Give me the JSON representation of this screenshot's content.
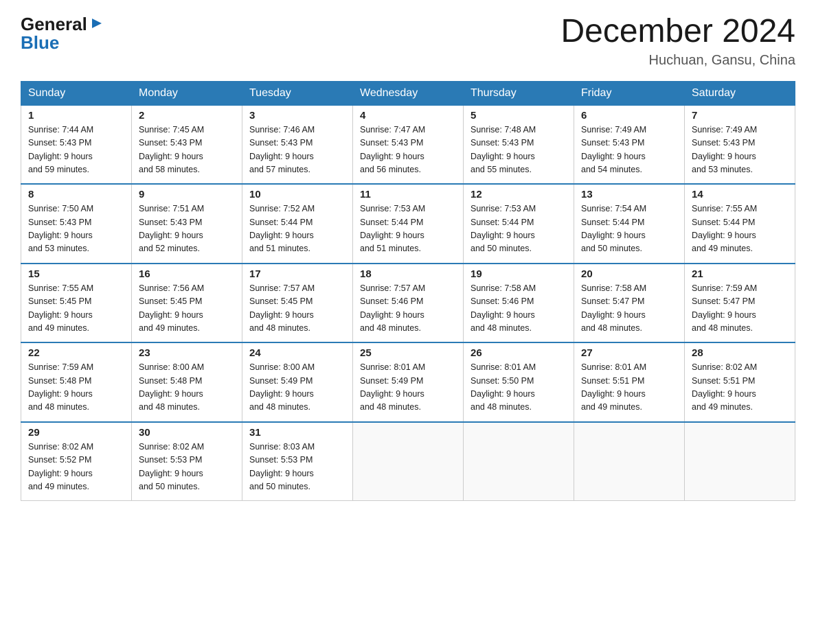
{
  "header": {
    "logo_line1": "General",
    "logo_line2": "Blue",
    "title": "December 2024",
    "subtitle": "Huchuan, Gansu, China"
  },
  "days_of_week": [
    "Sunday",
    "Monday",
    "Tuesday",
    "Wednesday",
    "Thursday",
    "Friday",
    "Saturday"
  ],
  "weeks": [
    [
      {
        "day": "1",
        "sunrise": "7:44 AM",
        "sunset": "5:43 PM",
        "daylight": "9 hours and 59 minutes."
      },
      {
        "day": "2",
        "sunrise": "7:45 AM",
        "sunset": "5:43 PM",
        "daylight": "9 hours and 58 minutes."
      },
      {
        "day": "3",
        "sunrise": "7:46 AM",
        "sunset": "5:43 PM",
        "daylight": "9 hours and 57 minutes."
      },
      {
        "day": "4",
        "sunrise": "7:47 AM",
        "sunset": "5:43 PM",
        "daylight": "9 hours and 56 minutes."
      },
      {
        "day": "5",
        "sunrise": "7:48 AM",
        "sunset": "5:43 PM",
        "daylight": "9 hours and 55 minutes."
      },
      {
        "day": "6",
        "sunrise": "7:49 AM",
        "sunset": "5:43 PM",
        "daylight": "9 hours and 54 minutes."
      },
      {
        "day": "7",
        "sunrise": "7:49 AM",
        "sunset": "5:43 PM",
        "daylight": "9 hours and 53 minutes."
      }
    ],
    [
      {
        "day": "8",
        "sunrise": "7:50 AM",
        "sunset": "5:43 PM",
        "daylight": "9 hours and 53 minutes."
      },
      {
        "day": "9",
        "sunrise": "7:51 AM",
        "sunset": "5:43 PM",
        "daylight": "9 hours and 52 minutes."
      },
      {
        "day": "10",
        "sunrise": "7:52 AM",
        "sunset": "5:44 PM",
        "daylight": "9 hours and 51 minutes."
      },
      {
        "day": "11",
        "sunrise": "7:53 AM",
        "sunset": "5:44 PM",
        "daylight": "9 hours and 51 minutes."
      },
      {
        "day": "12",
        "sunrise": "7:53 AM",
        "sunset": "5:44 PM",
        "daylight": "9 hours and 50 minutes."
      },
      {
        "day": "13",
        "sunrise": "7:54 AM",
        "sunset": "5:44 PM",
        "daylight": "9 hours and 50 minutes."
      },
      {
        "day": "14",
        "sunrise": "7:55 AM",
        "sunset": "5:44 PM",
        "daylight": "9 hours and 49 minutes."
      }
    ],
    [
      {
        "day": "15",
        "sunrise": "7:55 AM",
        "sunset": "5:45 PM",
        "daylight": "9 hours and 49 minutes."
      },
      {
        "day": "16",
        "sunrise": "7:56 AM",
        "sunset": "5:45 PM",
        "daylight": "9 hours and 49 minutes."
      },
      {
        "day": "17",
        "sunrise": "7:57 AM",
        "sunset": "5:45 PM",
        "daylight": "9 hours and 48 minutes."
      },
      {
        "day": "18",
        "sunrise": "7:57 AM",
        "sunset": "5:46 PM",
        "daylight": "9 hours and 48 minutes."
      },
      {
        "day": "19",
        "sunrise": "7:58 AM",
        "sunset": "5:46 PM",
        "daylight": "9 hours and 48 minutes."
      },
      {
        "day": "20",
        "sunrise": "7:58 AM",
        "sunset": "5:47 PM",
        "daylight": "9 hours and 48 minutes."
      },
      {
        "day": "21",
        "sunrise": "7:59 AM",
        "sunset": "5:47 PM",
        "daylight": "9 hours and 48 minutes."
      }
    ],
    [
      {
        "day": "22",
        "sunrise": "7:59 AM",
        "sunset": "5:48 PM",
        "daylight": "9 hours and 48 minutes."
      },
      {
        "day": "23",
        "sunrise": "8:00 AM",
        "sunset": "5:48 PM",
        "daylight": "9 hours and 48 minutes."
      },
      {
        "day": "24",
        "sunrise": "8:00 AM",
        "sunset": "5:49 PM",
        "daylight": "9 hours and 48 minutes."
      },
      {
        "day": "25",
        "sunrise": "8:01 AM",
        "sunset": "5:49 PM",
        "daylight": "9 hours and 48 minutes."
      },
      {
        "day": "26",
        "sunrise": "8:01 AM",
        "sunset": "5:50 PM",
        "daylight": "9 hours and 48 minutes."
      },
      {
        "day": "27",
        "sunrise": "8:01 AM",
        "sunset": "5:51 PM",
        "daylight": "9 hours and 49 minutes."
      },
      {
        "day": "28",
        "sunrise": "8:02 AM",
        "sunset": "5:51 PM",
        "daylight": "9 hours and 49 minutes."
      }
    ],
    [
      {
        "day": "29",
        "sunrise": "8:02 AM",
        "sunset": "5:52 PM",
        "daylight": "9 hours and 49 minutes."
      },
      {
        "day": "30",
        "sunrise": "8:02 AM",
        "sunset": "5:53 PM",
        "daylight": "9 hours and 50 minutes."
      },
      {
        "day": "31",
        "sunrise": "8:03 AM",
        "sunset": "5:53 PM",
        "daylight": "9 hours and 50 minutes."
      },
      null,
      null,
      null,
      null
    ]
  ]
}
